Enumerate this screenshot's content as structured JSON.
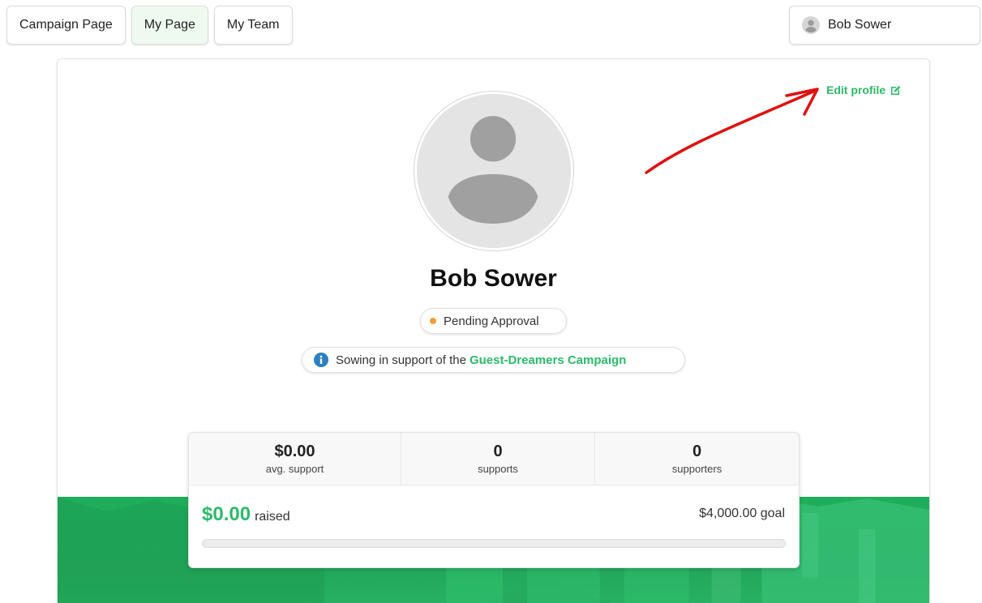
{
  "nav": {
    "tabs": [
      {
        "label": "Campaign Page",
        "active": false
      },
      {
        "label": "My Page",
        "active": true
      },
      {
        "label": "My Team",
        "active": false
      }
    ]
  },
  "user_menu": {
    "name": "Bob Sower",
    "icon": "user-circle-icon"
  },
  "profile": {
    "edit_label": "Edit profile",
    "name": "Bob Sower",
    "status": "Pending Approval",
    "support_text": "Sowing in support of the",
    "campaign_link": "Guest-Dreamers Campaign"
  },
  "stats": [
    {
      "value": "$0.00",
      "label": "avg. support"
    },
    {
      "value": "0",
      "label": "supports"
    },
    {
      "value": "0",
      "label": "supporters"
    }
  ],
  "fundraising": {
    "raised_amount": "$0.00",
    "raised_label": "raised",
    "goal": "$4,000.00 goal",
    "progress_fraction": 0
  },
  "colors": {
    "accent": "#2cba6a",
    "status_pending": "#f0a030",
    "info": "#2f7fc1",
    "annotation": "#e01010"
  }
}
